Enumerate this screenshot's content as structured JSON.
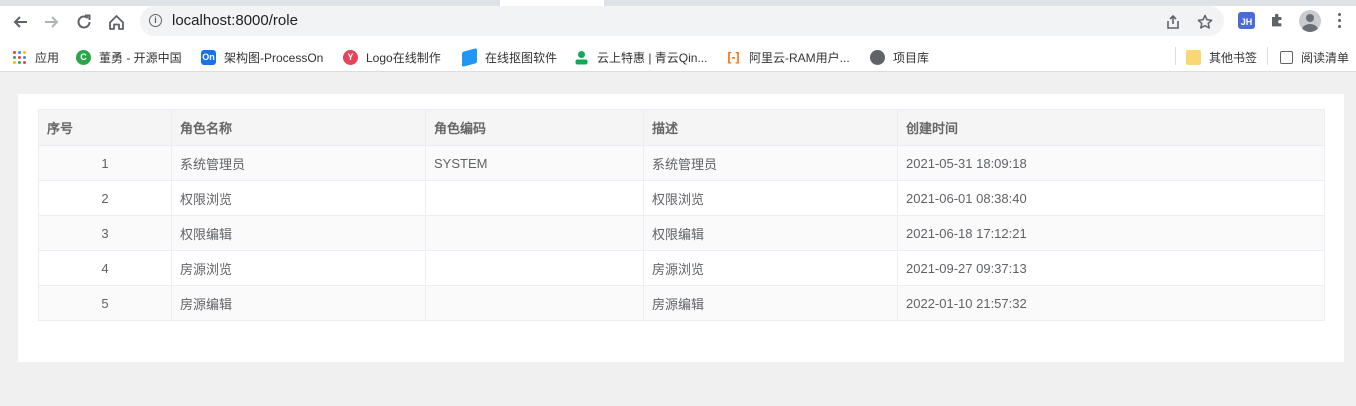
{
  "browser": {
    "url": "localhost:8000/role",
    "extension_badge": "JH"
  },
  "bookmarks": [
    {
      "label": "应用",
      "icon": "apps-grid-icon",
      "color": "#ea4335"
    },
    {
      "label": "董勇 - 开源中国",
      "icon": "oschina-icon",
      "color": "#2aa54a"
    },
    {
      "label": "架构图-ProcessOn",
      "icon": "processon-icon",
      "color": "#1874e6"
    },
    {
      "label": "Logo在线制作",
      "icon": "logo-maker-icon",
      "color": "#e9435a"
    },
    {
      "label": "在线抠图软件",
      "icon": "layers-icon",
      "color": "#2196f3"
    },
    {
      "label": "云上特惠 | 青云Qin...",
      "icon": "person-icon",
      "color": "#0fa958"
    },
    {
      "label": "阿里云-RAM用户...",
      "icon": "aliyun-icon",
      "color": "#ff6a00"
    },
    {
      "label": "项目库",
      "icon": "globe-icon",
      "color": "#5f6368"
    }
  ],
  "bookmarks_right": [
    {
      "label": "其他书签",
      "icon": "folder-icon"
    },
    {
      "label": "阅读清单",
      "icon": "reading-list-icon"
    }
  ],
  "table": {
    "columns": [
      "序号",
      "角色名称",
      "角色编码",
      "描述",
      "创建时间"
    ],
    "rows": [
      {
        "index": "1",
        "name": "系统管理员",
        "code": "SYSTEM",
        "desc": "系统管理员",
        "created": "2021-05-31 18:09:18"
      },
      {
        "index": "2",
        "name": "权限浏览",
        "code": "",
        "desc": "权限浏览",
        "created": "2021-06-01 08:38:40"
      },
      {
        "index": "3",
        "name": "权限编辑",
        "code": "",
        "desc": "权限编辑",
        "created": "2021-06-18 17:12:21"
      },
      {
        "index": "4",
        "name": "房源浏览",
        "code": "",
        "desc": "房源浏览",
        "created": "2021-09-27 09:37:13"
      },
      {
        "index": "5",
        "name": "房源编辑",
        "code": "",
        "desc": "房源编辑",
        "created": "2022-01-10 21:57:32"
      }
    ]
  }
}
